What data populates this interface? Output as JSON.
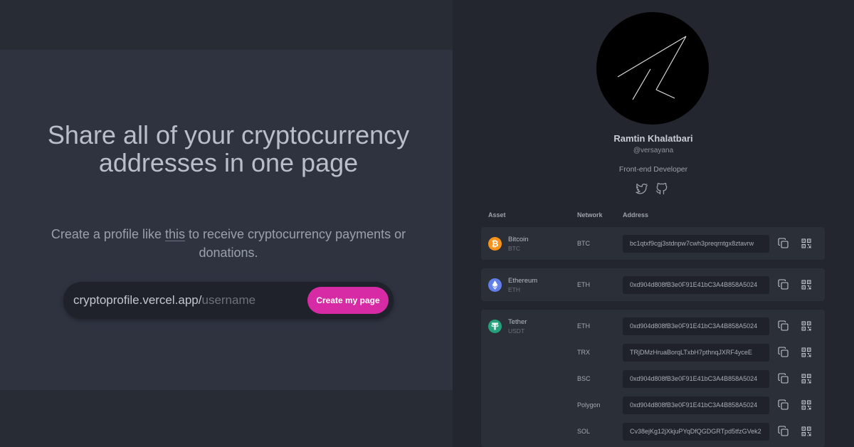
{
  "hero": {
    "headline": "Share all of your cryptocurrency addresses in one page",
    "sub_before": "Create a profile like ",
    "sub_link": "this",
    "sub_after": " to receive cryptocurrency payments or donations.",
    "url_prefix": "cryptoprofile.vercel.app/",
    "url_placeholder": "username",
    "create_button": "Create my page"
  },
  "profile": {
    "name": "Ramtin Khalatbari",
    "handle": "@versayana",
    "role": "Front-end Developer",
    "socials": [
      "twitter-icon",
      "github-icon"
    ]
  },
  "table": {
    "headers": {
      "asset": "Asset",
      "network": "Network",
      "address": "Address"
    },
    "assets": [
      {
        "name": "Bitcoin",
        "code": "BTC",
        "icon": "bitcoin-icon",
        "color": "#f7931a",
        "rows": [
          {
            "network": "BTC",
            "address": "bc1qtxf9cgj3stdnpw7cwh3preqrntgx8ztavrw"
          }
        ]
      },
      {
        "name": "Ethereum",
        "code": "ETH",
        "icon": "ethereum-icon",
        "color": "#627eea",
        "rows": [
          {
            "network": "ETH",
            "address": "0xd904d808fB3e0F91E41bC3A4B858A5024"
          }
        ]
      },
      {
        "name": "Tether",
        "code": "USDT",
        "icon": "tether-icon",
        "color": "#26a17b",
        "rows": [
          {
            "network": "ETH",
            "address": "0xd904d808fB3e0F91E41bC3A4B858A5024"
          },
          {
            "network": "TRX",
            "address": "TRjDMzHruaBorqLTxbH7pthnqJXRF4yceE"
          },
          {
            "network": "BSC",
            "address": "0xd904d808fB3e0F91E41bC3A4B858A5024"
          },
          {
            "network": "Polygon",
            "address": "0xd904d808fB3e0F91E41bC3A4B858A5024"
          },
          {
            "network": "SOL",
            "address": "Cv38ejKg12jXkjuPYqDfQGDGRTpd5tfzGVek2"
          }
        ]
      }
    ]
  },
  "colors": {
    "accent": "#d62ba4",
    "bg_left": "#2f3340",
    "bg_right": "#23262e"
  }
}
